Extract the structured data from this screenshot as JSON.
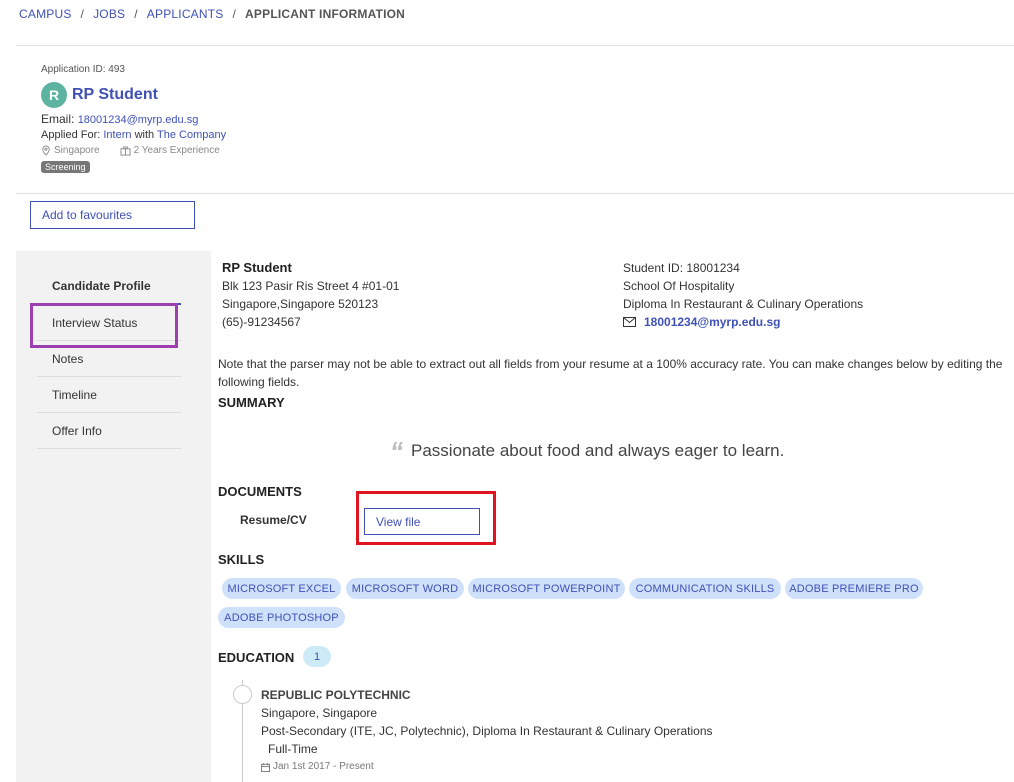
{
  "breadcrumb": {
    "items": [
      "CAMPUS",
      "JOBS",
      "APPLICANTS"
    ],
    "current": "APPLICANT INFORMATION",
    "separator": "/"
  },
  "applicant": {
    "application_id_label": "Application ID: 493",
    "avatar_letter": "R",
    "name": "RP Student",
    "email_label": "Email:",
    "email": "18001234@myrp.edu.sg",
    "applied_for_label": "Applied For:",
    "role": "Intern",
    "with_label": "with",
    "company": "The Company",
    "location": "Singapore",
    "experience": "2 Years Experience",
    "status": "Screening"
  },
  "actions": {
    "favourite_label": "Add to favourites"
  },
  "sidebar": {
    "items": [
      {
        "label": "Candidate Profile",
        "active": true
      },
      {
        "label": "Interview Status"
      },
      {
        "label": "Notes"
      },
      {
        "label": "Timeline"
      },
      {
        "label": "Offer Info"
      }
    ]
  },
  "profile": {
    "name": "RP Student",
    "address1": "Blk 123 Pasir Ris Street 4 #01-01",
    "address2": "Singapore,Singapore 520123",
    "phone": "(65)-91234567",
    "student_id": "Student ID: 18001234",
    "school": "School Of Hospitality",
    "diploma": "Diploma In Restaurant & Culinary Operations",
    "email": "18001234@myrp.edu.sg"
  },
  "parser_note": "Note that the parser may not be able to extract out all fields from your resume at a 100% accuracy rate. You can make changes below by editing the following fields.",
  "summary": {
    "title": "SUMMARY",
    "quote_mark": "“",
    "text": "Passionate about food and always eager to learn."
  },
  "documents": {
    "title": "DOCUMENTS",
    "resume_label": "Resume/CV",
    "view_label": "View file"
  },
  "skills": {
    "title": "SKILLS",
    "items": [
      "MICROSOFT EXCEL",
      "MICROSOFT WORD",
      "MICROSOFT POWERPOINT",
      "COMMUNICATION SKILLS",
      "ADOBE PREMIERE PRO",
      "ADOBE PHOTOSHOP"
    ]
  },
  "education": {
    "title": "EDUCATION",
    "count": "1",
    "entries": [
      {
        "school": "REPUBLIC POLYTECHNIC",
        "location": "Singapore, Singapore",
        "level": "Post-Secondary (ITE, JC, Polytechnic), Diploma In Restaurant & Culinary Operations",
        "mode": "Full-Time",
        "dates": "Jan 1st 2017 - Present"
      }
    ]
  },
  "colors": {
    "accent": "#3f51b5",
    "avatar": "#5cb3a0",
    "chip_bg": "#cfe0fa",
    "highlight_purple": "#9c3fb0",
    "highlight_red": "#e0141e"
  },
  "icons": {
    "location": "map-pin-icon",
    "experience": "briefcase-icon",
    "email": "envelope-icon",
    "date": "calendar-icon"
  }
}
